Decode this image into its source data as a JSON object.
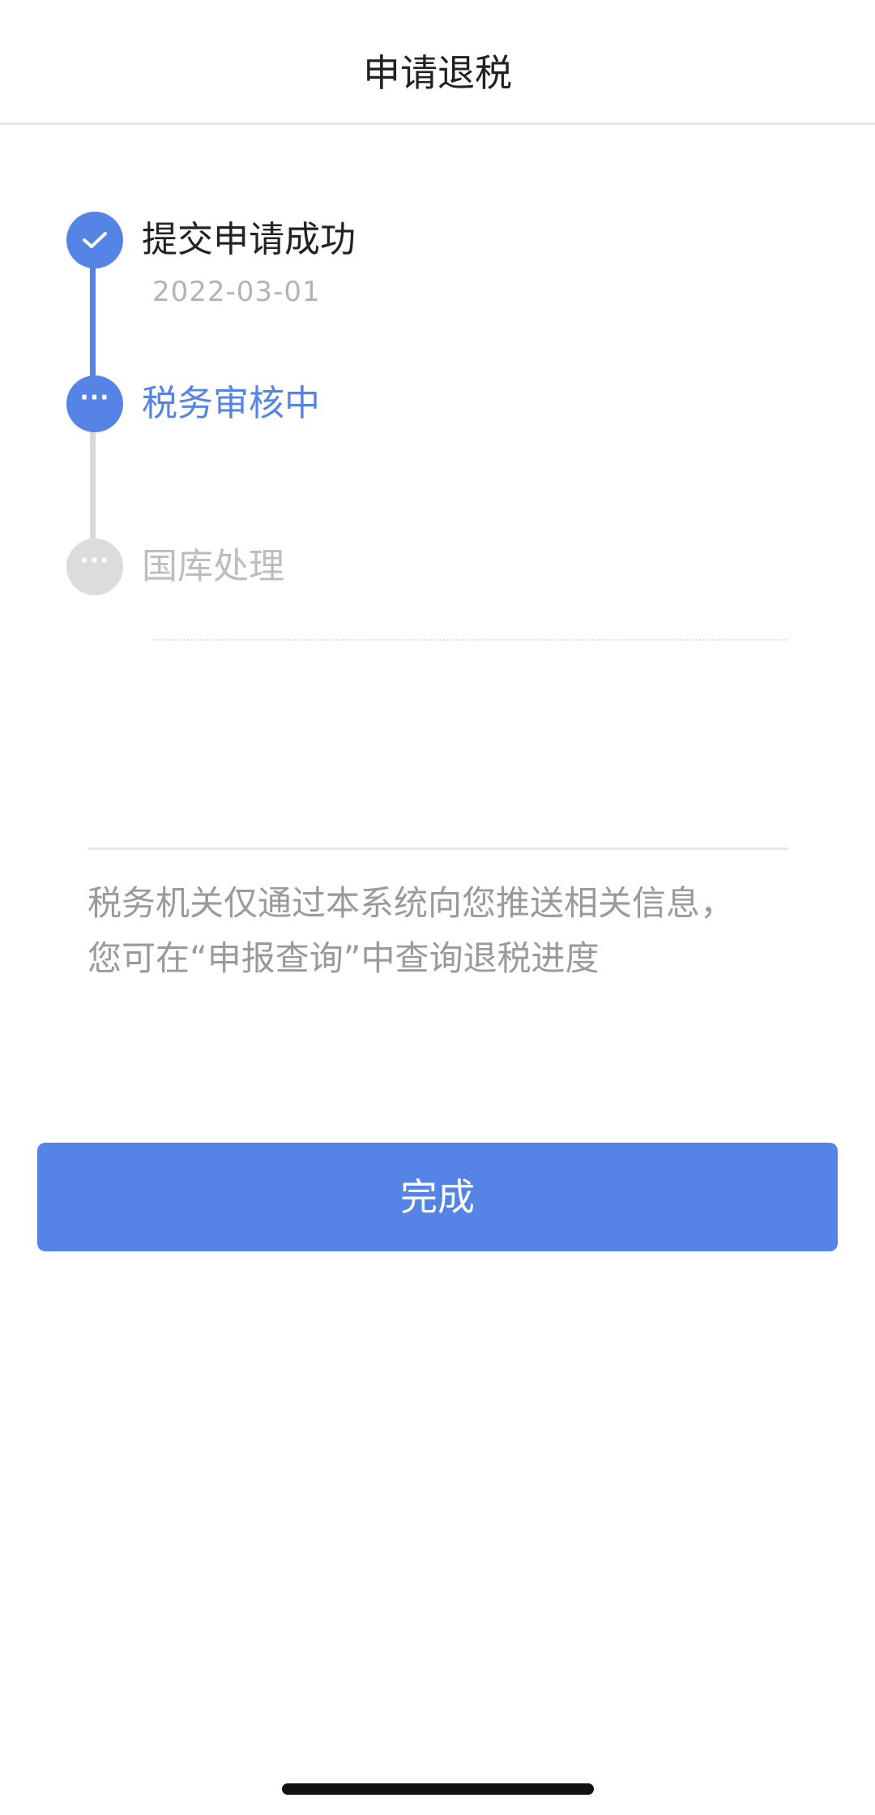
{
  "header": {
    "title": "申请退税"
  },
  "timeline": {
    "steps": [
      {
        "label": "提交申请成功",
        "date": "2022-03-01",
        "status": "done",
        "icon": "check-icon"
      },
      {
        "label": "税务审核中",
        "status": "active",
        "icon": "more-dots-icon"
      },
      {
        "label": "国库处理",
        "status": "pending",
        "icon": "more-dots-icon"
      }
    ]
  },
  "notice": {
    "line1": "税务机关仅通过本系统向您推送相关信息，",
    "line2": "您可在“申报查询”中查询退税进度"
  },
  "actions": {
    "done_label": "完成"
  },
  "colors": {
    "accent": "#5583e6",
    "pending": "#d9d9d9",
    "text_primary": "#222222",
    "text_secondary": "#9a9a9a"
  }
}
